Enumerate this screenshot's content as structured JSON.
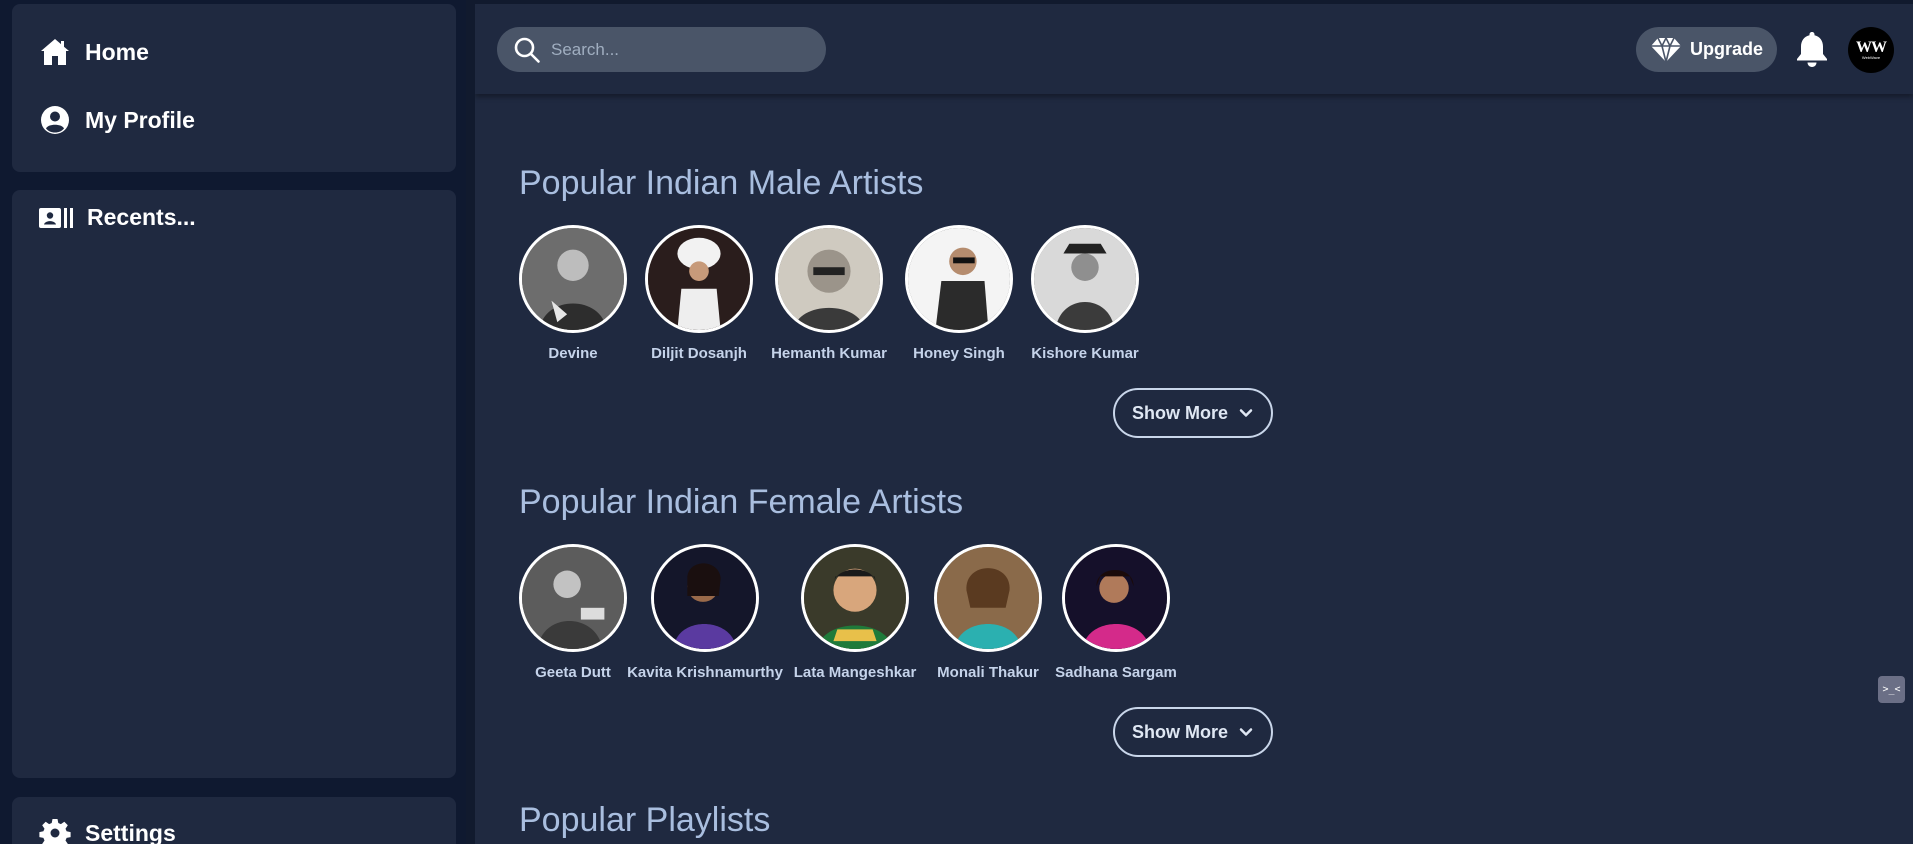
{
  "sidebar": {
    "nav": [
      {
        "label": "Home",
        "icon": "home-icon"
      },
      {
        "label": "My Profile",
        "icon": "user-circle-icon"
      }
    ],
    "recents_label": "Recents...",
    "recents_icon": "address-card-icon",
    "settings_label": "Settings",
    "settings_icon": "gear-icon"
  },
  "topbar": {
    "search_placeholder": "Search...",
    "upgrade_label": "Upgrade",
    "upgrade_icon": "diamond-icon",
    "bell_icon": "bell-icon",
    "avatar_initials": "WW",
    "avatar_subtitle": "WebWave"
  },
  "sections": {
    "male": {
      "title": "Popular Indian Male Artists",
      "artists": [
        "Devine",
        "Diljit Dosanjh",
        "Hemanth Kumar",
        "Honey Singh",
        "Kishore Kumar"
      ],
      "show_more": "Show More"
    },
    "female": {
      "title": "Popular Indian Female Artists",
      "artists": [
        "Geeta Dutt",
        "Kavita Krishnamurthy",
        "Lata Mangeshkar",
        "Monali Thakur",
        "Sadhana Sargam"
      ],
      "show_more": "Show More"
    },
    "playlists": {
      "title": "Popular Playlists"
    }
  },
  "colors": {
    "page_bg": "#111a2e",
    "panel_bg": "#1f2940",
    "pill_bg": "#4a5568",
    "section_title": "#a9bedf",
    "artist_name": "#c5d3ea"
  }
}
